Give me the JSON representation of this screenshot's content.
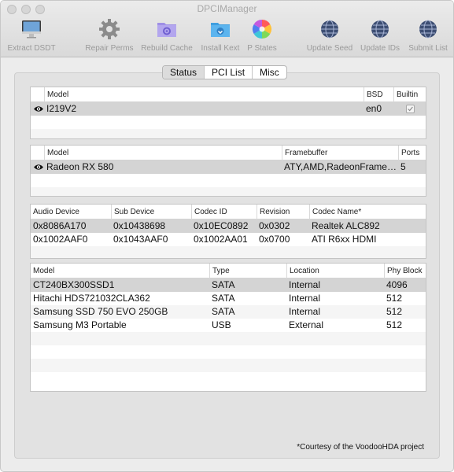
{
  "window": {
    "title": "DPCIManager"
  },
  "toolbar": {
    "extract_dsdt": {
      "label": "Extract DSDT",
      "icon": "imac-icon"
    },
    "repair_perms": {
      "label": "Repair Perms",
      "icon": "gear-icon"
    },
    "rebuild_cache": {
      "label": "Rebuild Cache",
      "icon": "folder-gear-icon"
    },
    "install_kext": {
      "label": "Install Kext",
      "icon": "folder-install-icon"
    },
    "p_states": {
      "label": "P States",
      "icon": "color-wheel-icon"
    },
    "update_seed": {
      "label": "Update Seed",
      "icon": "globe-icon"
    },
    "update_ids": {
      "label": "Update IDs",
      "icon": "globe-icon"
    },
    "submit_list": {
      "label": "Submit List",
      "icon": "globe-icon"
    }
  },
  "tabs": [
    {
      "label": "Status",
      "selected": true
    },
    {
      "label": "PCI List",
      "selected": false
    },
    {
      "label": "Misc",
      "selected": false
    }
  ],
  "network": {
    "headers": {
      "model": "Model",
      "bsd": "BSD",
      "builtin": "Builtin"
    },
    "rows": [
      {
        "model": "I219V2",
        "bsd": "en0",
        "builtin": true
      }
    ]
  },
  "graphics": {
    "headers": {
      "model": "Model",
      "framebuffer": "Framebuffer",
      "ports": "Ports"
    },
    "rows": [
      {
        "model": "Radeon RX 580",
        "framebuffer": "ATY,AMD,RadeonFrame…",
        "ports": "5"
      }
    ]
  },
  "audio": {
    "headers": {
      "audio_device": "Audio Device",
      "sub_device": "Sub Device",
      "codec_id": "Codec ID",
      "revision": "Revision",
      "codec_name": "Codec Name*"
    },
    "rows": [
      {
        "audio_device": "0x8086A170",
        "sub_device": "0x10438698",
        "codec_id": "0x10EC0892",
        "revision": "0x0302",
        "codec_name": "Realtek ALC892"
      },
      {
        "audio_device": "0x1002AAF0",
        "sub_device": "0x1043AAF0",
        "codec_id": "0x1002AA01",
        "revision": "0x0700",
        "codec_name": "ATI R6xx HDMI"
      }
    ]
  },
  "storage": {
    "headers": {
      "model": "Model",
      "type": "Type",
      "location": "Location",
      "phy_block": "Phy Block"
    },
    "rows": [
      {
        "model": "CT240BX300SSD1",
        "type": "SATA",
        "location": "Internal",
        "phy_block": "4096"
      },
      {
        "model": "Hitachi HDS721032CLA362",
        "type": "SATA",
        "location": "Internal",
        "phy_block": "512"
      },
      {
        "model": "Samsung SSD 750 EVO 250GB",
        "type": "SATA",
        "location": "Internal",
        "phy_block": "512"
      },
      {
        "model": "Samsung M3 Portable",
        "type": "USB",
        "location": "External",
        "phy_block": "512"
      }
    ]
  },
  "footnote": "*Courtesy of the VoodooHDA project"
}
